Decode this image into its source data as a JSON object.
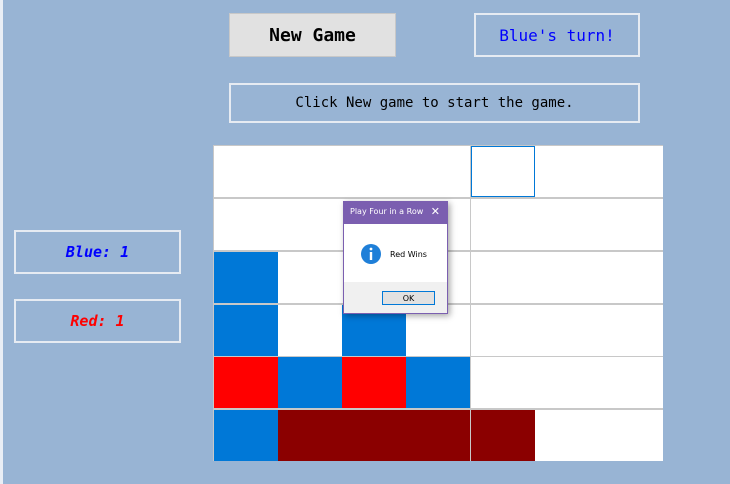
{
  "header": {
    "new_game_label": "New Game",
    "turn_text": "Blue's turn!",
    "status_text": "Click New game to start the game."
  },
  "scores": {
    "blue_text": "Blue: 1",
    "red_text": "Red: 1"
  },
  "board": {
    "rows": 6,
    "cols": 7,
    "highlighted_cell": {
      "row": 0,
      "col": 4
    },
    "cells": [
      [
        "empty",
        "empty",
        "empty",
        "empty",
        "empty",
        "empty",
        "empty"
      ],
      [
        "empty",
        "empty",
        "empty",
        "empty",
        "empty",
        "empty",
        "empty"
      ],
      [
        "blue",
        "empty",
        "empty",
        "empty",
        "empty",
        "empty",
        "empty"
      ],
      [
        "blue",
        "empty",
        "blue",
        "empty",
        "empty",
        "empty",
        "empty"
      ],
      [
        "red",
        "blue",
        "red",
        "blue",
        "empty",
        "empty",
        "empty"
      ],
      [
        "blue",
        "win",
        "win",
        "win",
        "win",
        "empty",
        "empty"
      ]
    ]
  },
  "colors": {
    "empty": "#ffffff",
    "blue": "#0078d7",
    "red": "#ff0000",
    "win": "#8b0000",
    "highlight": "#0078d7"
  },
  "dialog": {
    "title": "Play Four in a Row",
    "close_glyph": "✕",
    "message": "Red Wins",
    "ok_label": "OK",
    "icon": "info-icon"
  }
}
